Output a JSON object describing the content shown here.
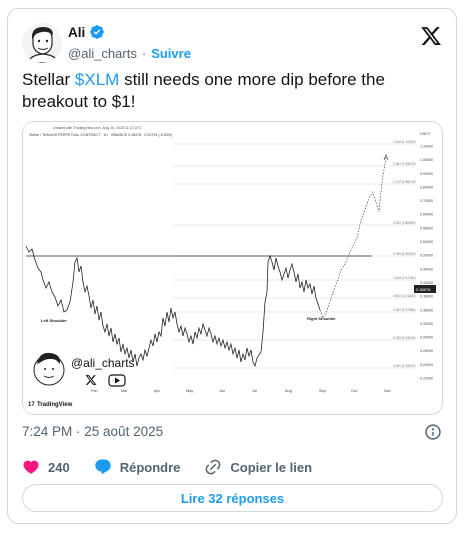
{
  "author": {
    "display_name": "Ali",
    "handle": "@ali_charts",
    "separator": "·",
    "follow_label": "Suivre"
  },
  "tweet": {
    "text_before": "Stellar ",
    "cashtag": "$XLM",
    "text_after": " still needs one more dip before the breakout to $1!"
  },
  "media": {
    "header_line": "created with TradingView.com, Aug 25, 2025 11:12 UTC",
    "symbol_line": "Stellar / TetherUS PERPETUAL CONTRACT · 1D · BINANCE 0.38978 · 0.03794 (-8.55%)",
    "currency": "USDT",
    "months": [
      "Feb",
      "Mar",
      "Apr",
      "May",
      "Jun",
      "Jul",
      "Aug",
      "Sep",
      "Oct",
      "Nov"
    ],
    "price_ticks": [
      "1.10000",
      "1.00000",
      "0.90000",
      "0.80000",
      "0.70000",
      "0.64000",
      "0.58000",
      "0.54000",
      "0.50000",
      "0.46000",
      "0.42000",
      "0.38000",
      "0.35000",
      "0.32000",
      "0.29000",
      "0.26000",
      "0.24000",
      "0.22000"
    ],
    "fib_labels": [
      "1.618 (1.10000)",
      "1.382 (0.95675)",
      "1.272 (0.88175)",
      "1.000 (0.65963)",
      "0.786 (0.50000)",
      "0.618 (0.47350)",
      "0.500 (0.41630)",
      "0.382 (0.37880)",
      "0.236 (0.33000)",
      "0.000 (0.25000)"
    ],
    "current_price": "0.38978",
    "annotations": {
      "left_shoulder": "Left Shoulder",
      "right_shoulder": "Right Shoulder"
    },
    "watermark_handle": "@ali_charts",
    "tradingview_logo": "TradingView"
  },
  "meta": {
    "timestamp": "7:24 PM · 25 août 2025"
  },
  "actions": {
    "like_count": "240",
    "reply_label": "Répondre",
    "copy_label": "Copier le lien"
  },
  "replies_button": "Lire 32 réponses",
  "colors": {
    "accent": "#1d9bf0",
    "like": "#f91880",
    "text": "#0f1419",
    "muted": "#536471"
  },
  "icons": [
    "verified-badge-icon",
    "x-logo-icon",
    "info-icon",
    "heart-icon",
    "reply-icon",
    "link-icon"
  ]
}
